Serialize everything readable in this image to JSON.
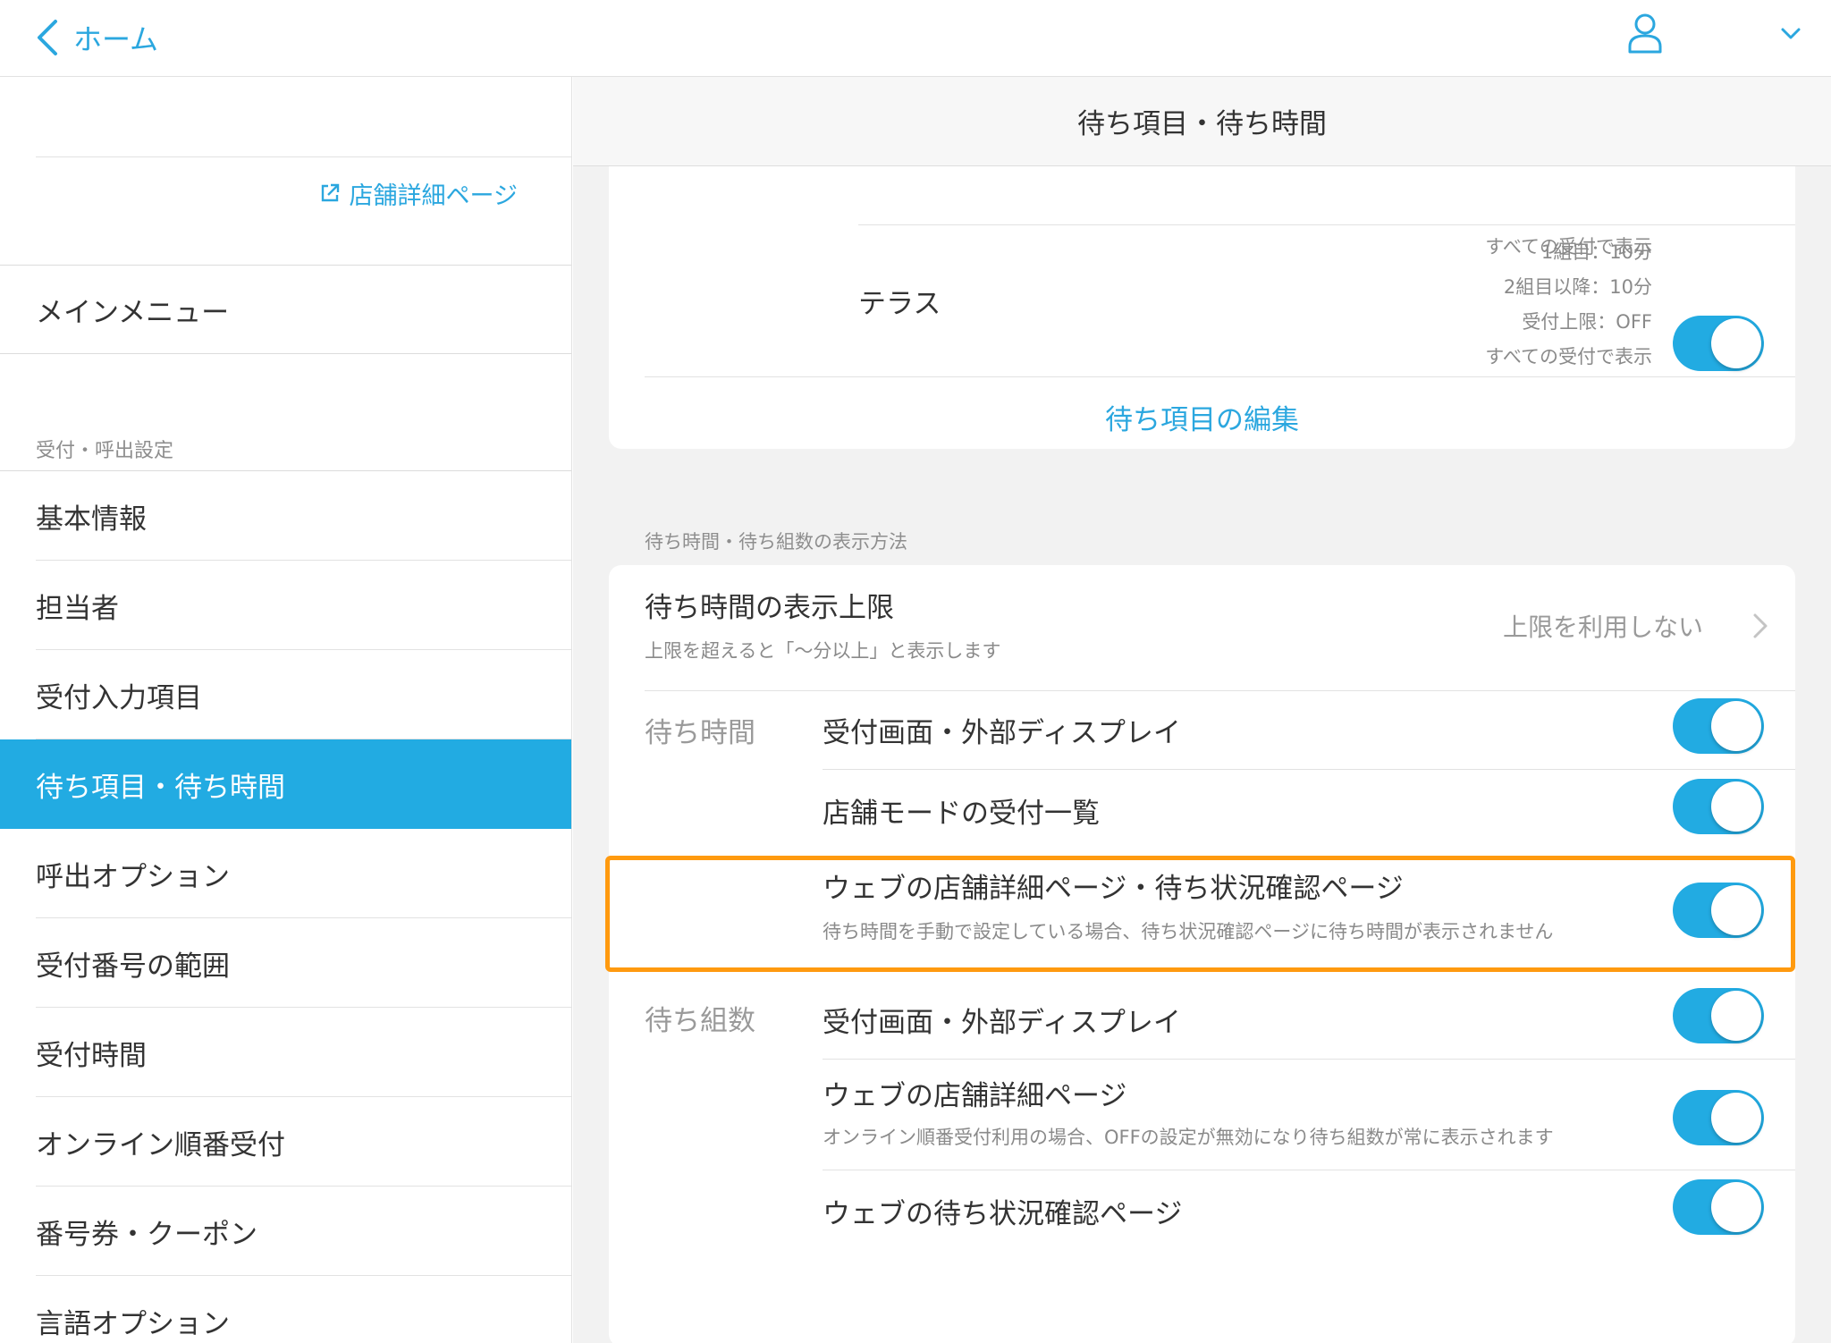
{
  "topbar": {
    "back_label": "ホーム",
    "colors": {
      "accent": "#2ba7df"
    },
    "icons": {
      "back": "chevron-left-icon",
      "user": "user-icon",
      "menu": "chevron-down-icon"
    }
  },
  "sidebar": {
    "store_link_label": "店舗詳細ページ",
    "main_menu_label": "メインメニュー",
    "section_label": "受付・呼出設定",
    "items": [
      {
        "label": "基本情報",
        "active": false
      },
      {
        "label": "担当者",
        "active": false
      },
      {
        "label": "受付入力項目",
        "active": false
      },
      {
        "label": "待ち項目・待ち時間",
        "active": true
      },
      {
        "label": "呼出オプション",
        "active": false
      },
      {
        "label": "受付番号の範囲",
        "active": false
      },
      {
        "label": "受付時間",
        "active": false
      },
      {
        "label": "オンライン順番受付",
        "active": false
      },
      {
        "label": "番号券・クーポン",
        "active": false
      },
      {
        "label": "言語オプション",
        "active": false
      }
    ],
    "active_color": "#22abe2"
  },
  "content": {
    "header_title": "待ち項目・待ち時間",
    "wait_items_card": {
      "clipped_hint": "すべての受付で表示",
      "terrace": {
        "label": "テラス",
        "info_lines": [
          "1組目：10分",
          "2組目以降：10分",
          "受付上限：OFF",
          "すべての受付で表示"
        ],
        "toggle_on": true
      },
      "edit_link_label": "待ち項目の編集"
    },
    "display_section_label": "待ち時間・待ち組数の表示方法",
    "display_limit": {
      "title": "待ち時間の表示上限",
      "subtitle": "上限を超えると「〜分以上」と表示します",
      "value": "上限を利用しない"
    },
    "wait_time_group": {
      "label": "待ち時間",
      "rows": [
        {
          "title": "受付画面・外部ディスプレイ",
          "toggle_on": true
        },
        {
          "title": "店舗モードの受付一覧",
          "toggle_on": true
        },
        {
          "title": "ウェブの店舗詳細ページ・待ち状況確認ページ",
          "subtitle": "待ち時間を手動で設定している場合、待ち状況確認ページに待ち時間が表示されません",
          "toggle_on": true
        }
      ]
    },
    "wait_count_group": {
      "label": "待ち組数",
      "rows": [
        {
          "title": "受付画面・外部ディスプレイ",
          "toggle_on": true
        },
        {
          "title": "ウェブの店舗詳細ページ",
          "subtitle": "オンライン順番受付利用の場合、OFFの設定が無効になり待ち組数が常に表示されます",
          "toggle_on": true
        },
        {
          "title": "ウェブの待ち状況確認ページ",
          "toggle_on": true
        }
      ]
    },
    "highlight_color": "#ff9a0f"
  }
}
